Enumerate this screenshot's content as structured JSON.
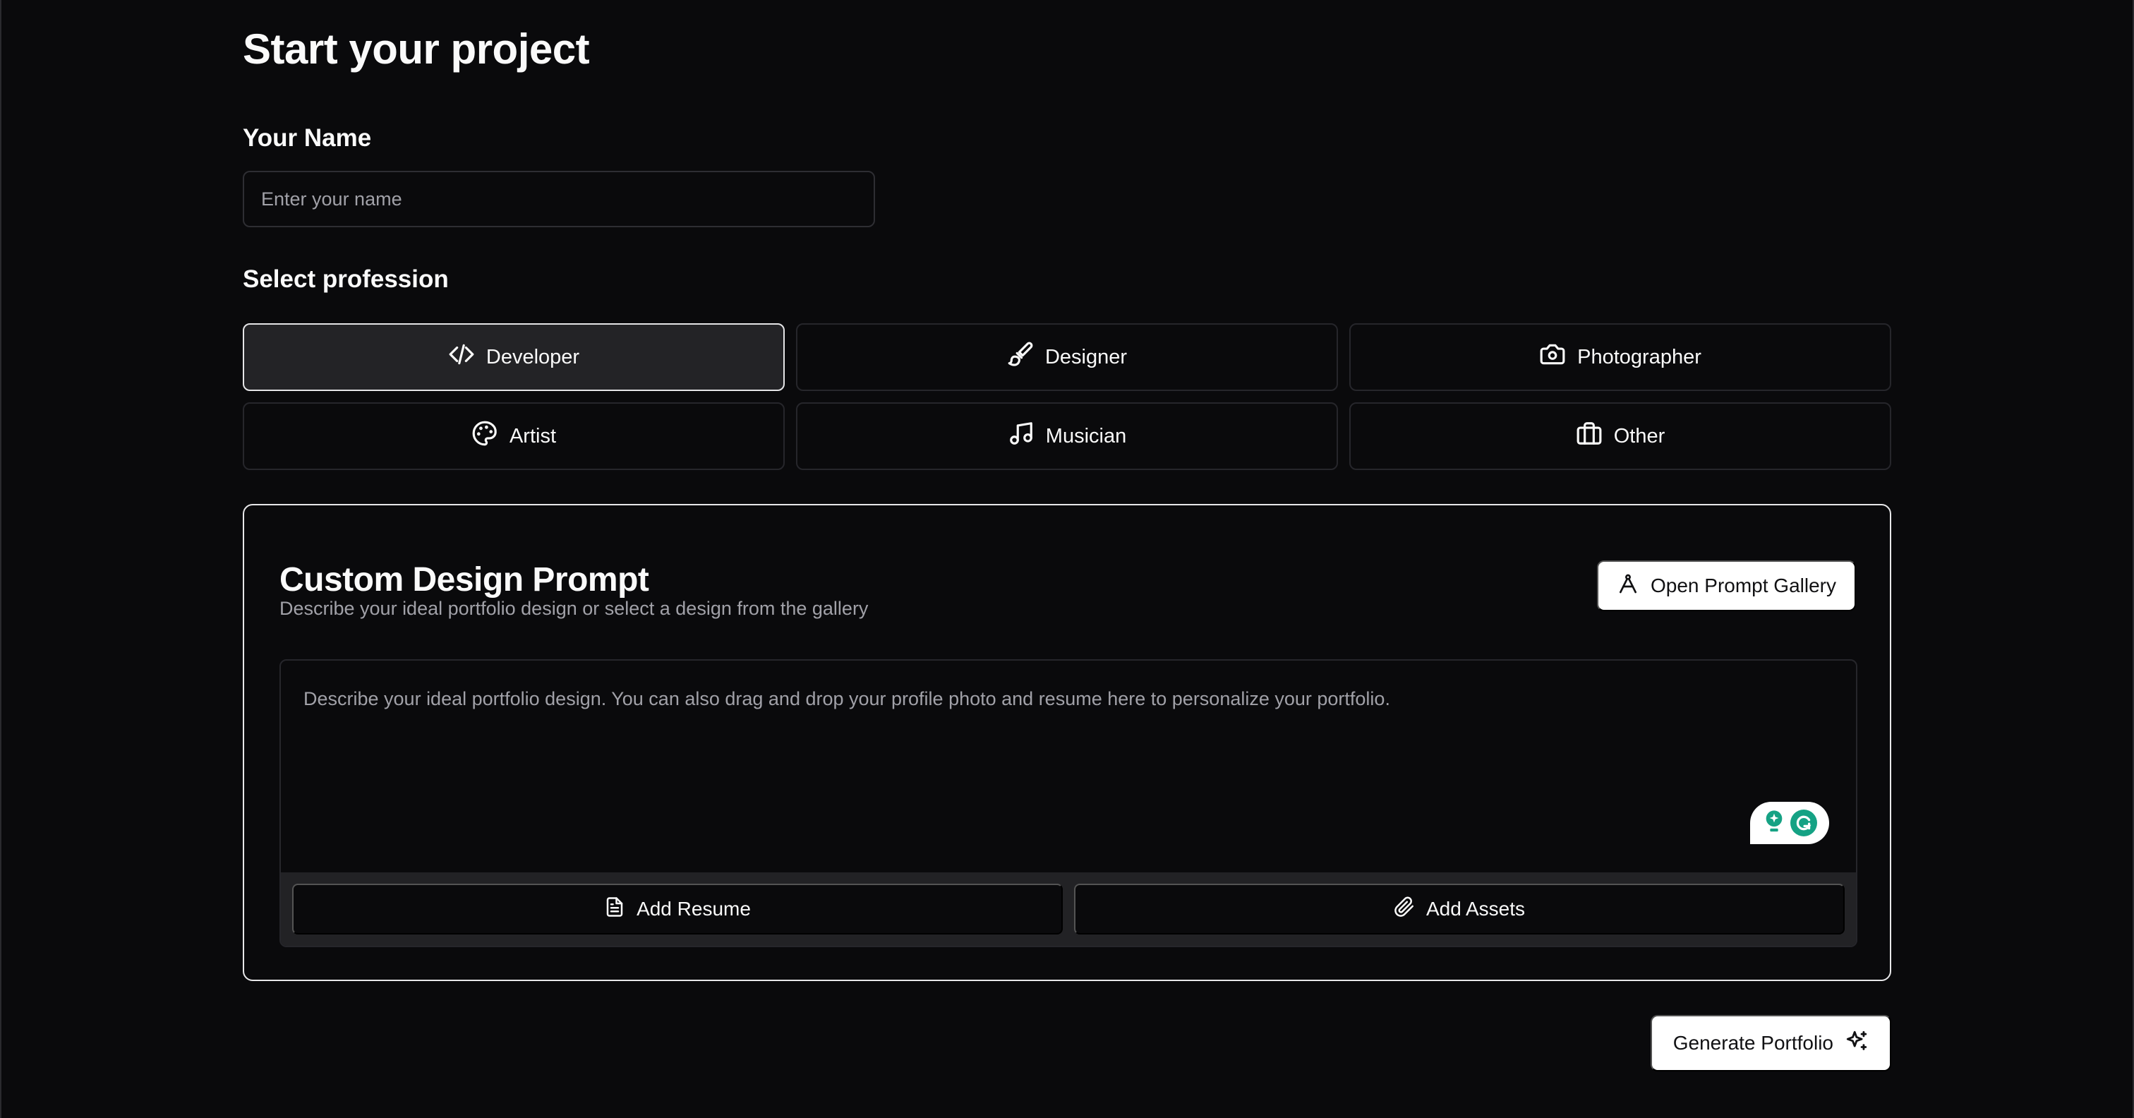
{
  "page": {
    "title": "Start your project"
  },
  "name_section": {
    "label": "Your Name",
    "input_value": "",
    "placeholder": "Enter your name"
  },
  "profession_section": {
    "label": "Select profession",
    "selected": "Developer",
    "options": [
      {
        "label": "Developer",
        "icon": "code-icon"
      },
      {
        "label": "Designer",
        "icon": "paintbrush-icon"
      },
      {
        "label": "Photographer",
        "icon": "camera-icon"
      },
      {
        "label": "Artist",
        "icon": "palette-icon"
      },
      {
        "label": "Musician",
        "icon": "music-note-icon"
      },
      {
        "label": "Other",
        "icon": "briefcase-icon"
      }
    ]
  },
  "prompt_card": {
    "title": "Custom Design Prompt",
    "subtitle": "Describe your ideal portfolio design or select a design from the gallery",
    "gallery_button": "Open Prompt Gallery",
    "textarea_value": "",
    "textarea_placeholder": "Describe your ideal portfolio design. You can also drag and drop your profile photo and resume here to personalize your portfolio.",
    "add_resume_label": "Add Resume",
    "add_assets_label": "Add Assets"
  },
  "actions": {
    "generate_label": "Generate Portfolio"
  },
  "colors": {
    "background": "#0a0a0c",
    "text": "#fafafa",
    "muted": "#a1a1a8",
    "border": "#26262b",
    "selected_bg": "#232326",
    "grammarly": "#15a284"
  }
}
